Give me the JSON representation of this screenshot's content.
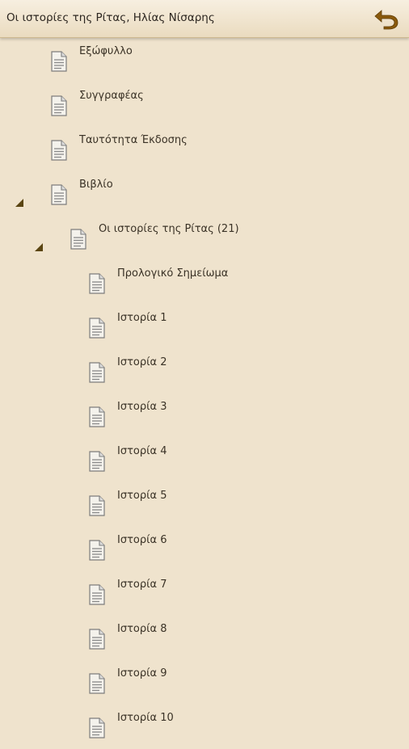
{
  "header": {
    "title": "Οι ιστορίες της Ρίτας, Ηλίας Νίσαρης",
    "back_icon": "undo-arrow-icon",
    "accent_color": "#8a5a0c"
  },
  "tree": {
    "nodes": [
      {
        "label": "Εξώφυλλο",
        "level": 0
      },
      {
        "label": "Συγγραφέας",
        "level": 0
      },
      {
        "label": "Ταυτότητα Έκδοσης",
        "level": 0
      },
      {
        "label": "Βιβλίο",
        "level": 0,
        "expanded": true
      },
      {
        "label": "Οι ιστορίες της Ρίτας (21)",
        "level": 1,
        "expanded": true
      },
      {
        "label": "Προλογικό Σημείωμα",
        "level": 2
      },
      {
        "label": "Ιστορία 1",
        "level": 2
      },
      {
        "label": "Ιστορία 2",
        "level": 2
      },
      {
        "label": "Ιστορία 3",
        "level": 2
      },
      {
        "label": "Ιστορία 4",
        "level": 2
      },
      {
        "label": "Ιστορία 5",
        "level": 2
      },
      {
        "label": "Ιστορία 6",
        "level": 2
      },
      {
        "label": "Ιστορία 7",
        "level": 2
      },
      {
        "label": "Ιστορία 8",
        "level": 2
      },
      {
        "label": "Ιστορία 9",
        "level": 2
      },
      {
        "label": "Ιστορία 10",
        "level": 2
      }
    ],
    "node_icon": "document-icon",
    "expander_icon": "expanded-triangle-icon"
  }
}
